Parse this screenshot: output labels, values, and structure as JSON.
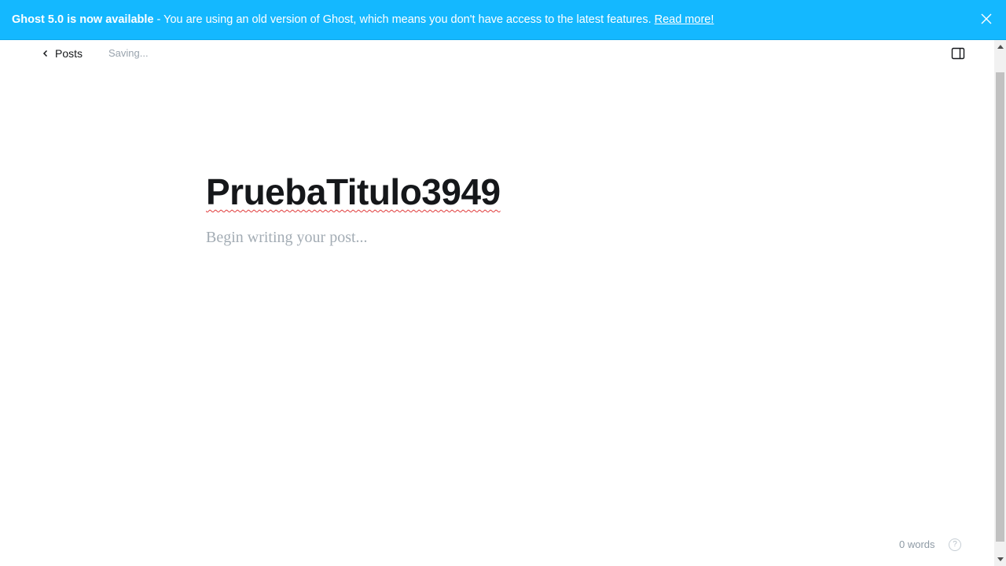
{
  "banner": {
    "bold_text": "Ghost 5.0 is now available",
    "message": " - You are using an old version of Ghost, which means you don't have access to the latest features.",
    "link_label": "Read more!",
    "close_icon": "close-icon",
    "background_color": "#14b8ff"
  },
  "topbar": {
    "back_label": "Posts",
    "back_icon": "chevron-left-icon",
    "status": "Saving...",
    "sidebar_icon": "sidebar-toggle-icon"
  },
  "editor": {
    "title": "PruebaTitulo3949",
    "body_placeholder": "Begin writing your post..."
  },
  "footer": {
    "word_count": "0 words",
    "help_label": "?"
  }
}
